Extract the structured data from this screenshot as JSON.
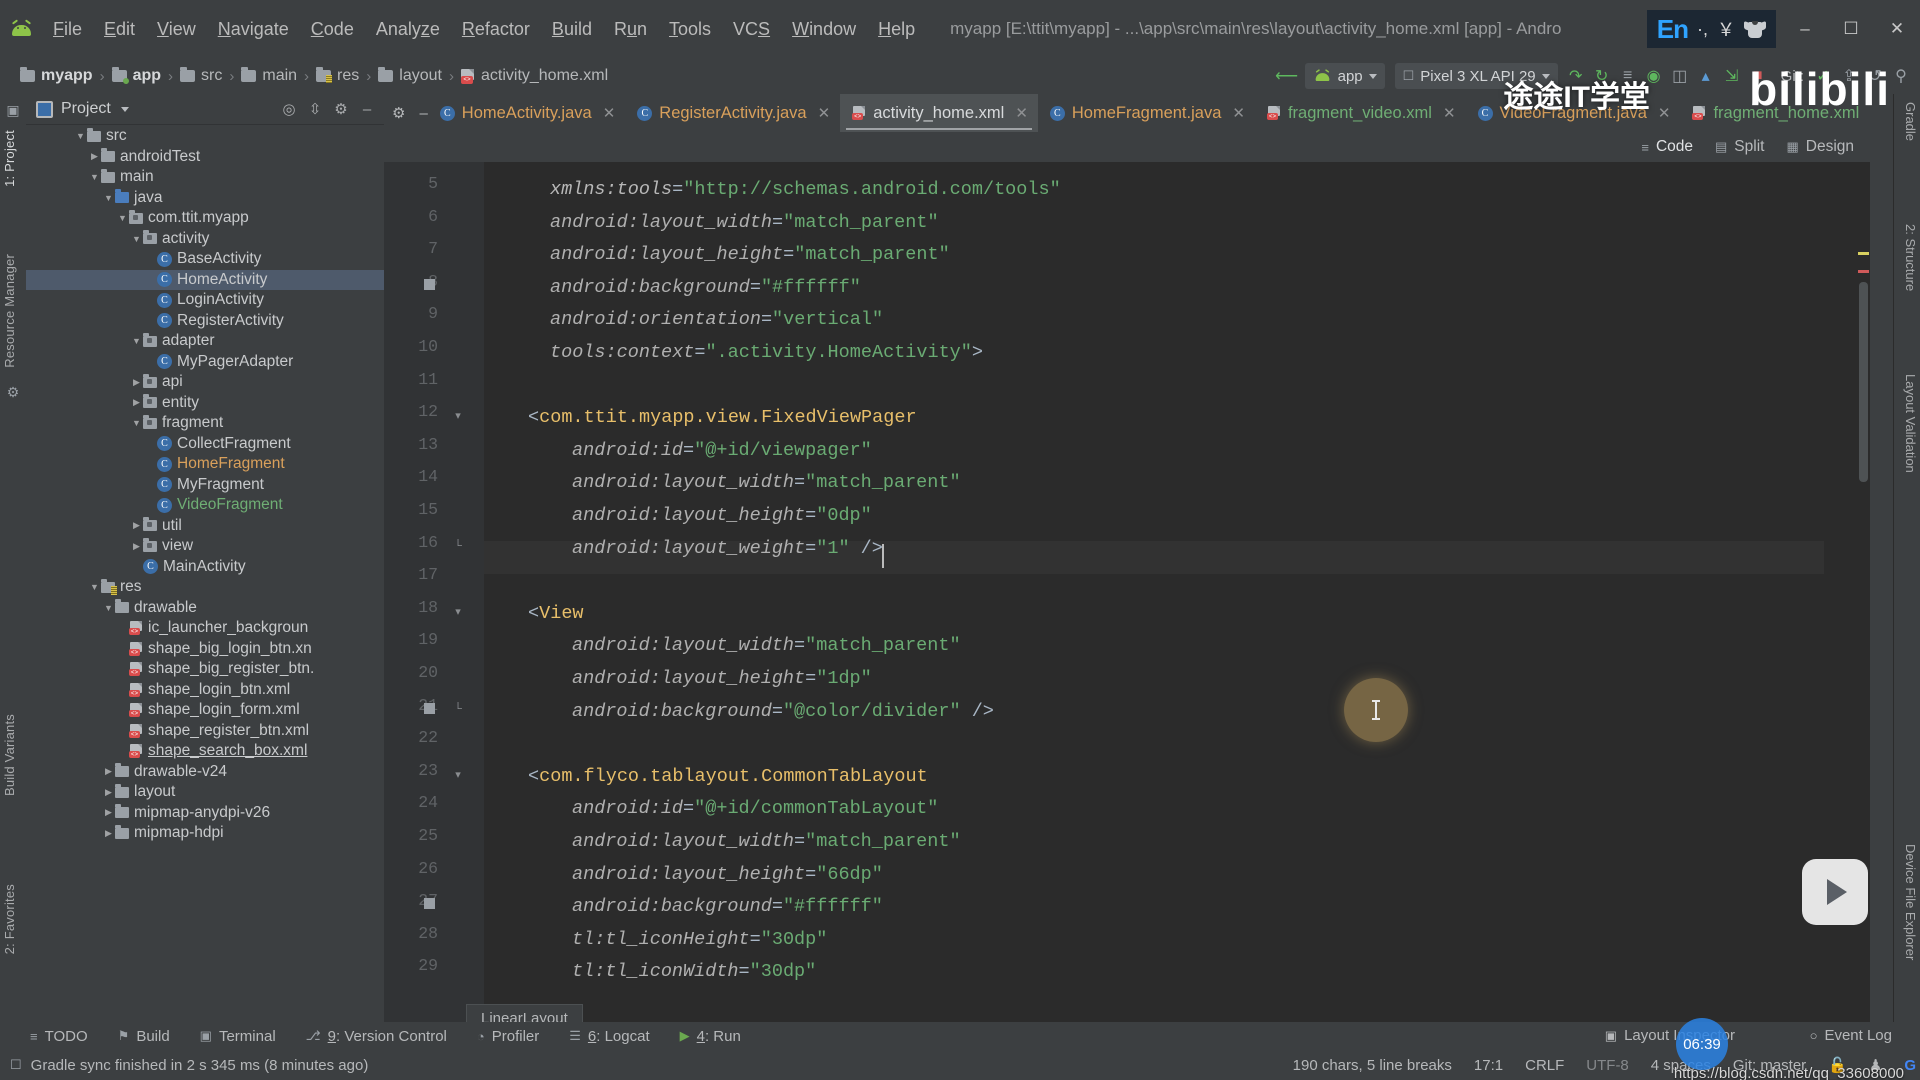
{
  "window": {
    "title": "myapp [E:\\ttit\\myapp] - ...\\app\\src\\main\\res\\layout\\activity_home.xml [app] - Andro",
    "minimize": "–",
    "maximize": "☐",
    "close": "✕"
  },
  "ime": {
    "lang": "En",
    "punct": "·,",
    "currency": "￥",
    "shirt_icon": "shirt-icon"
  },
  "menu": {
    "items": [
      {
        "label": "File",
        "mnemonic": "F"
      },
      {
        "label": "Edit",
        "mnemonic": "E"
      },
      {
        "label": "View",
        "mnemonic": "V"
      },
      {
        "label": "Navigate",
        "mnemonic": "N"
      },
      {
        "label": "Code",
        "mnemonic": "C"
      },
      {
        "label": "Analyze",
        "mnemonic": "z"
      },
      {
        "label": "Refactor",
        "mnemonic": "R"
      },
      {
        "label": "Build",
        "mnemonic": "B"
      },
      {
        "label": "Run",
        "mnemonic": "u"
      },
      {
        "label": "Tools",
        "mnemonic": "T"
      },
      {
        "label": "VCS",
        "mnemonic": "S"
      },
      {
        "label": "Window",
        "mnemonic": "W"
      },
      {
        "label": "Help",
        "mnemonic": "H"
      }
    ]
  },
  "breadcrumbs": [
    {
      "label": "myapp",
      "icon": "folder-icon",
      "bold": true
    },
    {
      "label": "app",
      "icon": "module-folder-icon",
      "bold": true
    },
    {
      "label": "src",
      "icon": "folder-icon",
      "bold": false
    },
    {
      "label": "main",
      "icon": "folder-icon",
      "bold": false
    },
    {
      "label": "res",
      "icon": "res-folder-icon",
      "bold": false
    },
    {
      "label": "layout",
      "icon": "folder-icon",
      "bold": false
    },
    {
      "label": "activity_home.xml",
      "icon": "xml-file-icon",
      "bold": false
    }
  ],
  "toolbar": {
    "module_selector": "app",
    "device_selector": "Pixel 3 XL API 29",
    "git_label": "Git:",
    "icons": [
      "back-arrow-icon",
      "run-icon",
      "debug-icon",
      "attach-debugger-icon",
      "profiler-icon",
      "apply-changes-icon",
      "avd-manager-icon",
      "sdk-manager-icon",
      "stop-icon"
    ]
  },
  "project_panel": {
    "title": "Project",
    "header_icons": [
      "locate-icon",
      "collapse-all-icon",
      "settings-gear-icon",
      "hide-icon"
    ],
    "tree": [
      {
        "label": "src",
        "indent": 3,
        "arrow": "down",
        "icon": "folder",
        "color": "white"
      },
      {
        "label": "androidTest",
        "indent": 4,
        "arrow": "right",
        "icon": "folder",
        "color": "white"
      },
      {
        "label": "main",
        "indent": 4,
        "arrow": "down",
        "icon": "folder",
        "color": "white"
      },
      {
        "label": "java",
        "indent": 5,
        "arrow": "down",
        "icon": "folder-blue",
        "color": "white"
      },
      {
        "label": "com.ttit.myapp",
        "indent": 6,
        "arrow": "down",
        "icon": "package",
        "color": "white"
      },
      {
        "label": "activity",
        "indent": 7,
        "arrow": "down",
        "icon": "package",
        "color": "white"
      },
      {
        "label": "BaseActivity",
        "indent": 8,
        "arrow": "none",
        "icon": "class",
        "color": "white"
      },
      {
        "label": "HomeActivity",
        "indent": 8,
        "arrow": "none",
        "icon": "class",
        "color": "white",
        "selected": true
      },
      {
        "label": "LoginActivity",
        "indent": 8,
        "arrow": "none",
        "icon": "class",
        "color": "white"
      },
      {
        "label": "RegisterActivity",
        "indent": 8,
        "arrow": "none",
        "icon": "class",
        "color": "white"
      },
      {
        "label": "adapter",
        "indent": 7,
        "arrow": "down",
        "icon": "package",
        "color": "white"
      },
      {
        "label": "MyPagerAdapter",
        "indent": 8,
        "arrow": "none",
        "icon": "class",
        "color": "white"
      },
      {
        "label": "api",
        "indent": 7,
        "arrow": "right",
        "icon": "package",
        "color": "white"
      },
      {
        "label": "entity",
        "indent": 7,
        "arrow": "right",
        "icon": "package",
        "color": "white"
      },
      {
        "label": "fragment",
        "indent": 7,
        "arrow": "down",
        "icon": "package",
        "color": "white"
      },
      {
        "label": "CollectFragment",
        "indent": 8,
        "arrow": "none",
        "icon": "class",
        "color": "white"
      },
      {
        "label": "HomeFragment",
        "indent": 8,
        "arrow": "none",
        "icon": "class",
        "color": "orange"
      },
      {
        "label": "MyFragment",
        "indent": 8,
        "arrow": "none",
        "icon": "class",
        "color": "white"
      },
      {
        "label": "VideoFragment",
        "indent": 8,
        "arrow": "none",
        "icon": "class",
        "color": "green"
      },
      {
        "label": "util",
        "indent": 7,
        "arrow": "right",
        "icon": "package",
        "color": "white"
      },
      {
        "label": "view",
        "indent": 7,
        "arrow": "right",
        "icon": "package",
        "color": "white"
      },
      {
        "label": "MainActivity",
        "indent": 7,
        "arrow": "none",
        "icon": "class",
        "color": "white"
      },
      {
        "label": "res",
        "indent": 4,
        "arrow": "down",
        "icon": "res-folder",
        "color": "white"
      },
      {
        "label": "drawable",
        "indent": 5,
        "arrow": "down",
        "icon": "folder",
        "color": "white"
      },
      {
        "label": "ic_launcher_backgroun",
        "indent": 6,
        "arrow": "none",
        "icon": "xml",
        "color": "white"
      },
      {
        "label": "shape_big_login_btn.xn",
        "indent": 6,
        "arrow": "none",
        "icon": "xml",
        "color": "white"
      },
      {
        "label": "shape_big_register_btn.",
        "indent": 6,
        "arrow": "none",
        "icon": "xml",
        "color": "white"
      },
      {
        "label": "shape_login_btn.xml",
        "indent": 6,
        "arrow": "none",
        "icon": "xml",
        "color": "white"
      },
      {
        "label": "shape_login_form.xml",
        "indent": 6,
        "arrow": "none",
        "icon": "xml",
        "color": "white"
      },
      {
        "label": "shape_register_btn.xml",
        "indent": 6,
        "arrow": "none",
        "icon": "xml",
        "color": "white"
      },
      {
        "label": "shape_search_box.xml",
        "indent": 6,
        "arrow": "none",
        "icon": "xml",
        "color": "white",
        "underline": true
      },
      {
        "label": "drawable-v24",
        "indent": 5,
        "arrow": "right",
        "icon": "folder",
        "color": "white"
      },
      {
        "label": "layout",
        "indent": 5,
        "arrow": "right",
        "icon": "folder",
        "color": "white"
      },
      {
        "label": "mipmap-anydpi-v26",
        "indent": 5,
        "arrow": "right",
        "icon": "folder",
        "color": "white"
      },
      {
        "label": "mipmap-hdpi",
        "indent": 5,
        "arrow": "right",
        "icon": "folder",
        "color": "white"
      }
    ]
  },
  "left_tool_strip": [
    {
      "label": "1: Project",
      "name": "tool-window-project"
    },
    {
      "label": "Resource Manager",
      "name": "tool-window-resource-manager"
    },
    {
      "label": "Build Variants",
      "name": "tool-window-build-variants"
    },
    {
      "label": "2: Favorites",
      "name": "tool-window-favorites"
    }
  ],
  "right_tool_strip": [
    {
      "label": "Gradle",
      "name": "tool-window-gradle"
    },
    {
      "label": "2: Structure",
      "name": "tool-window-structure"
    },
    {
      "label": "Layout Validation",
      "name": "tool-window-layout-validation"
    },
    {
      "label": "Device File Explorer",
      "name": "tool-window-device-file-explorer"
    }
  ],
  "editor_tabs": [
    {
      "label": "HomeActivity.java",
      "icon": "class",
      "active": false
    },
    {
      "label": "RegisterActivity.java",
      "icon": "class",
      "active": false
    },
    {
      "label": "activity_home.xml",
      "icon": "xml",
      "active": true
    },
    {
      "label": "HomeFragment.java",
      "icon": "class",
      "active": false
    },
    {
      "label": "fragment_video.xml",
      "icon": "xml",
      "active": false
    },
    {
      "label": "VideoFragment.java",
      "icon": "class",
      "active": false
    },
    {
      "label": "fragment_home.xml",
      "icon": "xml",
      "active": false
    }
  ],
  "view_modes": [
    {
      "label": "Code",
      "icon": "code-view-icon",
      "active": true
    },
    {
      "label": "Split",
      "icon": "split-view-icon",
      "active": false
    },
    {
      "label": "Design",
      "icon": "design-view-icon",
      "active": false
    }
  ],
  "code": {
    "first_line": 5,
    "lines": [
      {
        "n": 5,
        "indent": 3,
        "segments": [
          {
            "t": "xmlns:tools",
            "c": "ns"
          },
          {
            "t": "=",
            "c": "punct"
          },
          {
            "t": "\"http://schemas.android.com/tools\"",
            "c": "val"
          }
        ]
      },
      {
        "n": 6,
        "indent": 3,
        "segments": [
          {
            "t": "android:layout_width",
            "c": "attr"
          },
          {
            "t": "=",
            "c": "punct"
          },
          {
            "t": "\"match_parent\"",
            "c": "val"
          }
        ]
      },
      {
        "n": 7,
        "indent": 3,
        "segments": [
          {
            "t": "android:layout_height",
            "c": "attr"
          },
          {
            "t": "=",
            "c": "punct"
          },
          {
            "t": "\"match_parent\"",
            "c": "val"
          }
        ]
      },
      {
        "n": 8,
        "indent": 3,
        "segments": [
          {
            "t": "android:background",
            "c": "attr"
          },
          {
            "t": "=",
            "c": "punct"
          },
          {
            "t": "\"#ffffff\"",
            "c": "val"
          }
        ],
        "mark": true
      },
      {
        "n": 9,
        "indent": 3,
        "segments": [
          {
            "t": "android:orientation",
            "c": "attr"
          },
          {
            "t": "=",
            "c": "punct"
          },
          {
            "t": "\"vertical\"",
            "c": "val"
          }
        ]
      },
      {
        "n": 10,
        "indent": 3,
        "segments": [
          {
            "t": "tools:context",
            "c": "attr"
          },
          {
            "t": "=",
            "c": "punct"
          },
          {
            "t": "\".activity.HomeActivity\"",
            "c": "val"
          },
          {
            "t": ">",
            "c": "punct"
          }
        ]
      },
      {
        "n": 11,
        "indent": 0,
        "segments": []
      },
      {
        "n": 12,
        "indent": 2,
        "segments": [
          {
            "t": "<",
            "c": "punct"
          },
          {
            "t": "com.ttit.myapp.view.FixedViewPager",
            "c": "tag"
          }
        ],
        "fold": true
      },
      {
        "n": 13,
        "indent": 4,
        "segments": [
          {
            "t": "android:id",
            "c": "attr"
          },
          {
            "t": "=",
            "c": "punct"
          },
          {
            "t": "\"@+id/viewpager\"",
            "c": "val"
          }
        ]
      },
      {
        "n": 14,
        "indent": 4,
        "segments": [
          {
            "t": "android:layout_width",
            "c": "attr"
          },
          {
            "t": "=",
            "c": "punct"
          },
          {
            "t": "\"match_parent\"",
            "c": "val"
          }
        ]
      },
      {
        "n": 15,
        "indent": 4,
        "segments": [
          {
            "t": "android:layout_height",
            "c": "attr"
          },
          {
            "t": "=",
            "c": "punct"
          },
          {
            "t": "\"0dp\"",
            "c": "val"
          }
        ]
      },
      {
        "n": 16,
        "indent": 4,
        "segments": [
          {
            "t": "android:layout_weight",
            "c": "attr"
          },
          {
            "t": "=",
            "c": "punct"
          },
          {
            "t": "\"1\"",
            "c": "val"
          },
          {
            "t": " />",
            "c": "punct"
          }
        ],
        "fold_end": true
      },
      {
        "n": 17,
        "indent": 0,
        "segments": [],
        "current": true
      },
      {
        "n": 18,
        "indent": 2,
        "segments": [
          {
            "t": "<",
            "c": "punct"
          },
          {
            "t": "View",
            "c": "tag"
          }
        ],
        "fold": true
      },
      {
        "n": 19,
        "indent": 4,
        "segments": [
          {
            "t": "android:layout_width",
            "c": "attr"
          },
          {
            "t": "=",
            "c": "punct"
          },
          {
            "t": "\"match_parent\"",
            "c": "val"
          }
        ]
      },
      {
        "n": 20,
        "indent": 4,
        "segments": [
          {
            "t": "android:layout_height",
            "c": "attr"
          },
          {
            "t": "=",
            "c": "punct"
          },
          {
            "t": "\"1dp\"",
            "c": "val"
          }
        ]
      },
      {
        "n": 21,
        "indent": 4,
        "segments": [
          {
            "t": "android:background",
            "c": "attr"
          },
          {
            "t": "=",
            "c": "punct"
          },
          {
            "t": "\"@color/divider\"",
            "c": "val"
          },
          {
            "t": " />",
            "c": "punct"
          }
        ],
        "mark": true,
        "fold_end": true
      },
      {
        "n": 22,
        "indent": 0,
        "segments": []
      },
      {
        "n": 23,
        "indent": 2,
        "segments": [
          {
            "t": "<",
            "c": "punct"
          },
          {
            "t": "com.flyco.tablayout.CommonTabLayout",
            "c": "tag"
          }
        ],
        "fold": true
      },
      {
        "n": 24,
        "indent": 4,
        "segments": [
          {
            "t": "android:id",
            "c": "attr"
          },
          {
            "t": "=",
            "c": "punct"
          },
          {
            "t": "\"@+id/commonTabLayout\"",
            "c": "val"
          }
        ]
      },
      {
        "n": 25,
        "indent": 4,
        "segments": [
          {
            "t": "android:layout_width",
            "c": "attr"
          },
          {
            "t": "=",
            "c": "punct"
          },
          {
            "t": "\"match_parent\"",
            "c": "val"
          }
        ]
      },
      {
        "n": 26,
        "indent": 4,
        "segments": [
          {
            "t": "android:layout_height",
            "c": "attr"
          },
          {
            "t": "=",
            "c": "punct"
          },
          {
            "t": "\"66dp\"",
            "c": "val"
          }
        ]
      },
      {
        "n": 27,
        "indent": 4,
        "segments": [
          {
            "t": "android:background",
            "c": "attr"
          },
          {
            "t": "=",
            "c": "punct"
          },
          {
            "t": "\"#ffffff\"",
            "c": "val"
          }
        ],
        "mark": true
      },
      {
        "n": 28,
        "indent": 4,
        "segments": [
          {
            "t": "tl:tl_iconHeight",
            "c": "attr"
          },
          {
            "t": "=",
            "c": "punct"
          },
          {
            "t": "\"30dp\"",
            "c": "val"
          }
        ]
      },
      {
        "n": 29,
        "indent": 4,
        "segments": [
          {
            "t": "tl:tl_iconWidth",
            "c": "attr"
          },
          {
            "t": "=",
            "c": "punct"
          },
          {
            "t": "\"30dp\"",
            "c": "val"
          }
        ]
      }
    ]
  },
  "editor_status_breadcrumb": "LinearLayout",
  "bottom_tool_windows": [
    {
      "label": "TODO",
      "icon": "todo-icon",
      "mnemonic": ""
    },
    {
      "label": "Build",
      "icon": "build-hammer-icon",
      "mnemonic": ""
    },
    {
      "label": "Terminal",
      "icon": "terminal-icon",
      "mnemonic": ""
    },
    {
      "label": "9: Version Control",
      "icon": "vcs-branch-icon",
      "mnemonic": "9"
    },
    {
      "label": "Profiler",
      "icon": "profiler-icon",
      "mnemonic": ""
    },
    {
      "label": "6: Logcat",
      "icon": "logcat-icon",
      "mnemonic": "6"
    },
    {
      "label": "4: Run",
      "icon": "run-play-icon",
      "mnemonic": "4"
    }
  ],
  "right_dock": [
    {
      "label": "Layout Inspector",
      "icon": "layout-inspector-icon"
    },
    {
      "label": "Event Log",
      "icon": "event-log-icon"
    }
  ],
  "status_bar": {
    "message": "Gradle sync finished in 2 s 345 ms (8 minutes ago)",
    "message_icon": "memory-icon",
    "char_count": "190 chars, 5 line breaks",
    "caret_position": "17:1",
    "line_separator": "CRLF",
    "encoding": "UTF-8",
    "indent": "4 spaces",
    "branch": "Git: master",
    "lock_icon": "unlocked-icon",
    "inspector_icon": "hector-icon",
    "google_icon": "google-icon"
  },
  "overlays": {
    "watermark_cn": "途途IT学堂",
    "bilibili": "bilibili",
    "clock": "06:39",
    "csdn_url": "https://blog.csdn.net/qq_33608000"
  },
  "colors": {
    "background": "#3c3f41",
    "editor_bg": "#2b2b2b",
    "gutter_bg": "#313335",
    "accent_blue": "#3b6ea8",
    "green": "#6aab73",
    "attr_yellow": "#e8bf6a",
    "selection": "#4e5a6b"
  }
}
